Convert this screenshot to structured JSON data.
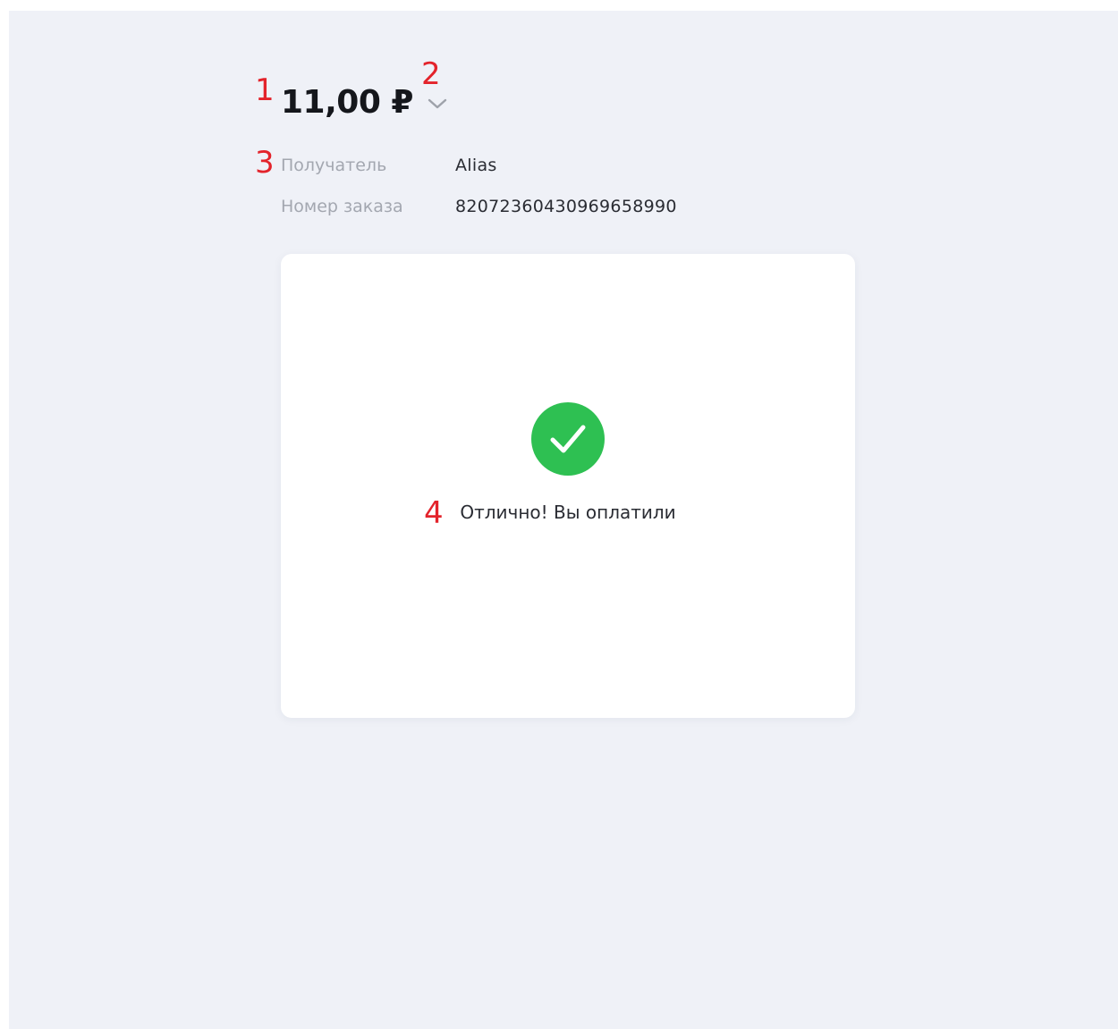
{
  "payment": {
    "amount": "11,00 ₽",
    "recipient_label": "Получатель",
    "recipient_value": "Alias",
    "order_label": "Номер заказа",
    "order_value": "82072360430969658990",
    "status_text": "Отлично! Вы оплатили"
  },
  "annotations": {
    "m1": "1",
    "m2": "2",
    "m3": "3",
    "m4": "4"
  },
  "icons": {
    "chevron": "chevron-down-icon",
    "success": "checkmark-icon"
  },
  "colors": {
    "background": "#eff1f7",
    "card": "#ffffff",
    "success": "#2ec052",
    "annotation": "#e3232b",
    "muted_text": "#a3a7b0",
    "text": "#2a2c33"
  }
}
